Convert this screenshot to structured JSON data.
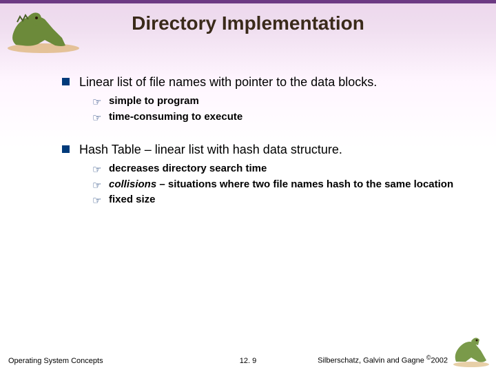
{
  "title": "Directory Implementation",
  "bullets": [
    {
      "text": "Linear list of file names with pointer to the data blocks.",
      "subs": [
        {
          "text": "simple to program"
        },
        {
          "text": "time-consuming to execute"
        }
      ]
    },
    {
      "text": "Hash Table – linear list with hash data structure.",
      "subs": [
        {
          "text": "decreases directory search time"
        },
        {
          "prefix_italic": "collisions",
          "rest": " – situations where two file names hash to the same location"
        },
        {
          "text": "fixed size"
        }
      ]
    }
  ],
  "footer": {
    "left": "Operating System Concepts",
    "center": "12. 9",
    "right_prefix": "Silberschatz, Galvin and  Gagne ",
    "right_copy": "©",
    "right_year": "2002"
  }
}
